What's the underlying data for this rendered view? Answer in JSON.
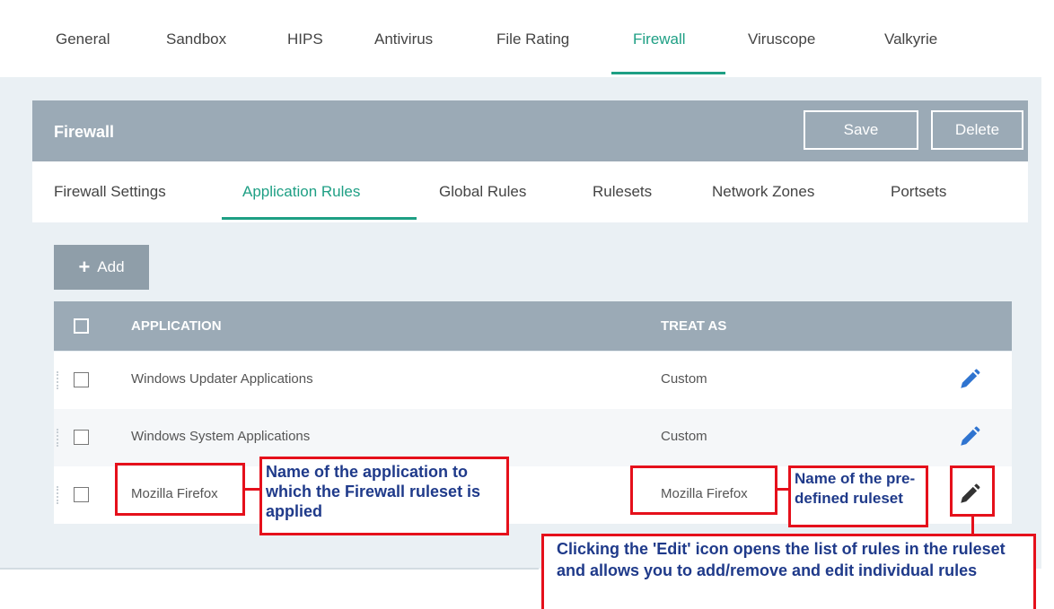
{
  "top_tabs": {
    "general": "General",
    "sandbox": "Sandbox",
    "hips": "HIPS",
    "antivirus": "Antivirus",
    "file_rating": "File Rating",
    "firewall": "Firewall",
    "viruscope": "Viruscope",
    "valkyrie": "Valkyrie"
  },
  "panel": {
    "title": "Firewall",
    "save_label": "Save",
    "delete_label": "Delete"
  },
  "sub_tabs": {
    "firewall_settings": "Firewall Settings",
    "application_rules": "Application Rules",
    "global_rules": "Global Rules",
    "rulesets": "Rulesets",
    "network_zones": "Network Zones",
    "portsets": "Portsets"
  },
  "add_button": {
    "label": "Add"
  },
  "table": {
    "headers": {
      "application": "APPLICATION",
      "treat_as": "TREAT AS"
    },
    "rows": [
      {
        "application": "Windows Updater Applications",
        "treat_as": "Custom",
        "icon_color": "#2f74d0"
      },
      {
        "application": "Windows System Applications",
        "treat_as": "Custom",
        "icon_color": "#2f74d0"
      },
      {
        "application": "Mozilla Firefox",
        "treat_as": "Mozilla Firefox",
        "icon_color": "#333333"
      }
    ]
  },
  "annotations": {
    "app_name": "Name of the application to which the Firewall ruleset is applied",
    "ruleset_name": "Name of the pre-defined ruleset",
    "edit_note": "Clicking the 'Edit' icon opens the list of rules in the ruleset and allows you to add/remove and edit individual rules"
  },
  "colors": {
    "accent": "#1e9f84",
    "header_bg": "#9baab6",
    "annotation_red": "#e5101b",
    "annotation_text": "#1f3a8a"
  }
}
